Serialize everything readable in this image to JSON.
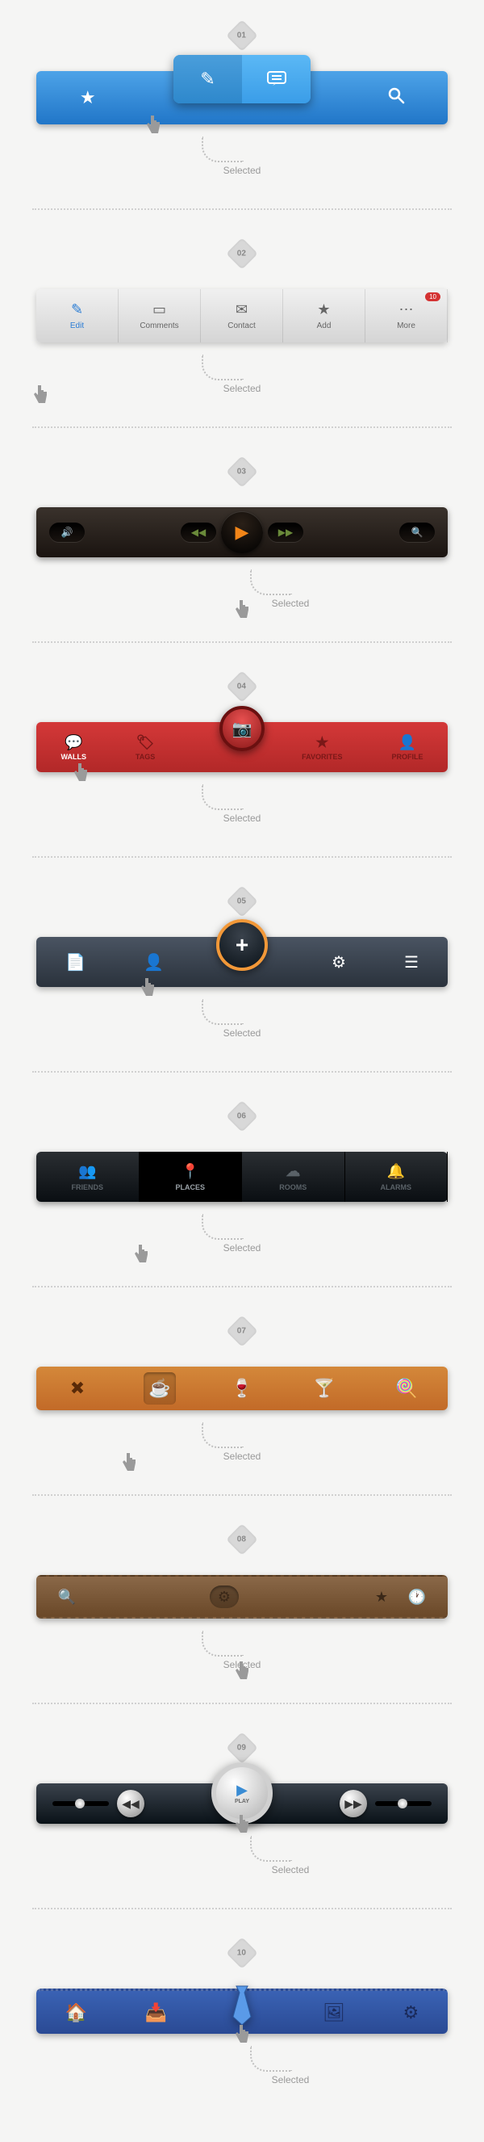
{
  "sections": [
    {
      "num": "01",
      "selected_label": "Selected"
    },
    {
      "num": "02",
      "selected_label": "Selected"
    },
    {
      "num": "03",
      "selected_label": "Selected"
    },
    {
      "num": "04",
      "selected_label": "Selected"
    },
    {
      "num": "05",
      "selected_label": "Selected"
    },
    {
      "num": "06",
      "selected_label": "Selected"
    },
    {
      "num": "07",
      "selected_label": "Selected"
    },
    {
      "num": "08",
      "selected_label": "Selected"
    },
    {
      "num": "09",
      "selected_label": "Selected"
    },
    {
      "num": "10",
      "selected_label": "Selected"
    }
  ],
  "bar2": {
    "items": [
      "Edit",
      "Comments",
      "Contact",
      "Add",
      "More"
    ],
    "badge": "10"
  },
  "bar4": {
    "items": [
      "WALLS",
      "TAGS",
      "",
      "FAVORITES",
      "PROFILE"
    ]
  },
  "bar6": {
    "items": [
      "FRIENDS",
      "PLACES",
      "ROOMS",
      "ALARMS"
    ]
  },
  "bar9": {
    "play_label": "PLAY"
  }
}
